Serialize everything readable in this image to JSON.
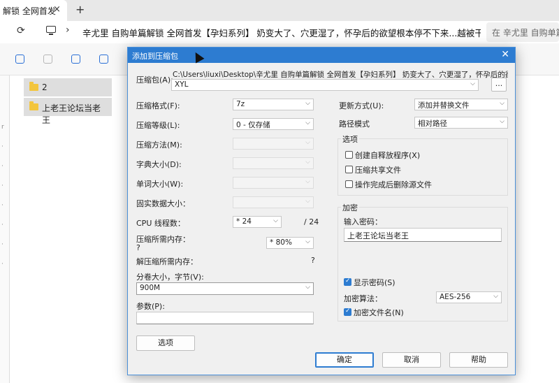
{
  "browser": {
    "tab_title": "解锁 全网首发",
    "tab_close": "×",
    "new_tab": "+",
    "url": "辛尤里 自购单篇解锁 全网首发【孕妇系列】 奶变大了、穴更湿了，怀孕后的欲望根本停不下来...越被干越湿",
    "search_text": "在 辛尤里 自购单篇解锁"
  },
  "explorer": {
    "files": [
      {
        "name": "2"
      },
      {
        "name": "上老王论坛当老王"
      }
    ]
  },
  "dialog": {
    "title": "添加到压缩包",
    "close": "✕",
    "archive_label": "压缩包(A):",
    "archive_path": "C:\\Users\\liuxi\\Desktop\\辛尤里 自购单篇解锁 全网首发【孕妇系列】 奶变大了、穴更湿了，怀孕后的欲望根本停",
    "archive_name": "XYL",
    "browse": "...",
    "format_label": "压缩格式(F):",
    "format_value": "7z",
    "level_label": "压缩等级(L):",
    "level_value": "0 - 仅存储",
    "method_label": "压缩方法(M):",
    "dict_label": "字典大小(D):",
    "word_label": "单词大小(W):",
    "solid_label": "固实数据大小：",
    "cpu_label": "CPU 线程数：",
    "cpu_value": "* 24",
    "cpu_total": "/ 24",
    "mem_label": "压缩所需内存：",
    "mem_question": "?",
    "mem_value": "* 80%",
    "decomp_label": "解压缩所需内存：",
    "decomp_value": "?",
    "split_label": "分卷大小，字节(V):",
    "split_value": "900M",
    "params_label": "参数(P):",
    "options_button": "选项",
    "update_label": "更新方式(U):",
    "update_value": "添加并替换文件",
    "path_label": "路径模式",
    "path_value": "相对路径",
    "options_group": "选项",
    "opt_sfx": "创建自释放程序(X)",
    "opt_shared": "压缩共享文件",
    "opt_delete": "操作完成后删除源文件",
    "enc_group": "加密",
    "pwd_label": "输入密码：",
    "pwd_value": "上老王论坛当老王",
    "show_pwd": "显示密码(S)",
    "algo_label": "加密算法：",
    "algo_value": "AES-256",
    "enc_names": "加密文件名(N)",
    "ok": "确定",
    "cancel": "取消",
    "help": "帮助",
    "dropdown_arrow": "⌵"
  }
}
